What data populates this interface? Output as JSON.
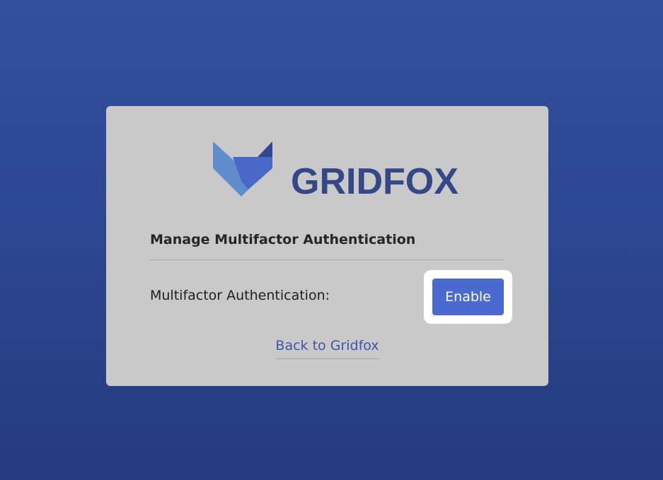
{
  "brand": {
    "name": "GRIDFOX",
    "logo_icon": "fox-icon",
    "text_color": "#344787"
  },
  "page": {
    "section_title": "Manage Multifactor Authentication",
    "mfa_label": "Multifactor Authentication:",
    "enable_button_label": "Enable",
    "back_link_label": "Back to Gridfox"
  },
  "colors": {
    "background_top": "#33509f",
    "background_bottom": "#243b7e",
    "card": "#c9c9c9",
    "button": "#4a6ad0",
    "link": "#3d56a8"
  }
}
